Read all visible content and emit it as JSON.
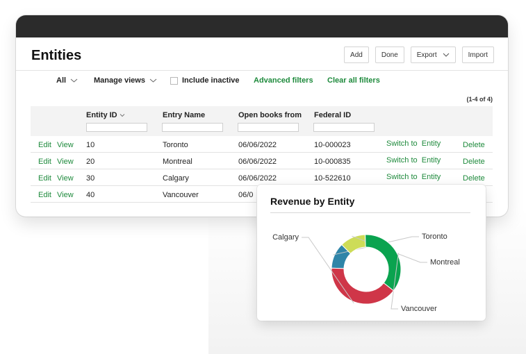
{
  "page": {
    "title": "Entities"
  },
  "toolbar": {
    "add": "Add",
    "done": "Done",
    "export": "Export",
    "import": "Import"
  },
  "filters": {
    "all": "All",
    "manage_views": "Manage views",
    "include_inactive": "Include inactive",
    "include_inactive_checked": false,
    "advanced": "Advanced filters",
    "clear": "Clear all filters"
  },
  "record_count": "(1-4 of 4)",
  "table": {
    "columns": [
      "Entity ID",
      "Entry Name",
      "Open books from",
      "Federal ID"
    ],
    "sort_column": "Entity ID",
    "rows": [
      {
        "edit": "Edit",
        "view": "View",
        "id": "10",
        "name": "Toronto",
        "books": "06/06/2022",
        "federal": "10-000023",
        "switch": "Switch to  Entity",
        "delete": "Delete"
      },
      {
        "edit": "Edit",
        "view": "View",
        "id": "20",
        "name": "Montreal",
        "books": "06/06/2022",
        "federal": "10-000835",
        "switch": "Switch to  Entity",
        "delete": "Delete"
      },
      {
        "edit": "Edit",
        "view": "View",
        "id": "30",
        "name": "Calgary",
        "books": "06/06/2022",
        "federal": "10-522610",
        "switch": "Switch to  Entity",
        "delete": "Delete"
      },
      {
        "edit": "Edit",
        "view": "View",
        "id": "40",
        "name": "Vancouver",
        "books": "06/0",
        "federal": "",
        "switch": "",
        "delete": ""
      }
    ]
  },
  "chart_data": {
    "type": "pie",
    "title": "Revenue by Entity",
    "donut": true,
    "categories": [
      "Toronto",
      "Montreal",
      "Vancouver",
      "Calgary"
    ],
    "values": [
      12,
      12,
      36,
      40
    ],
    "colors": [
      "#2f85a8",
      "#cddc58",
      "#0aa34f",
      "#cf3648"
    ]
  },
  "colors": {
    "accent": "#1e8a3c",
    "titlebar": "#2b2b2b"
  }
}
